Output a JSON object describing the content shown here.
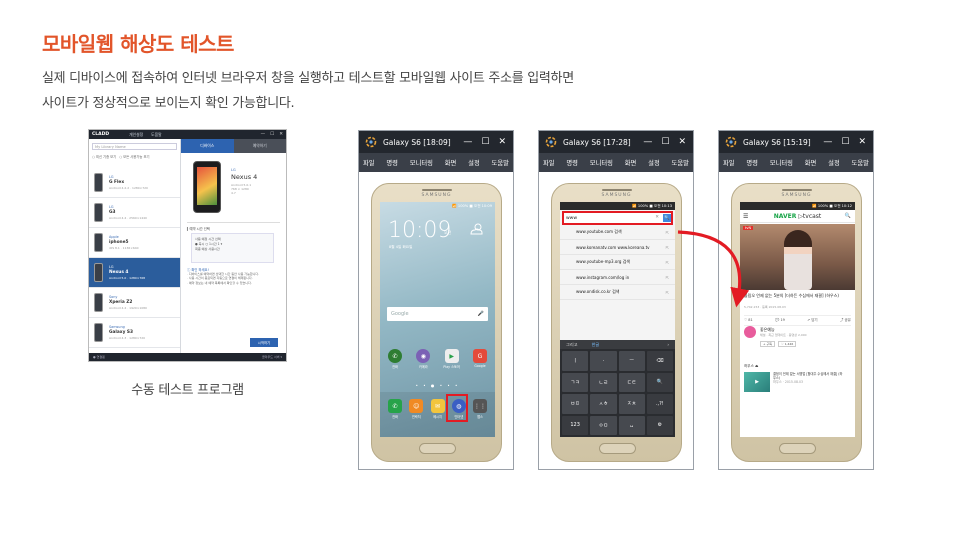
{
  "header": {
    "title": "모바일웹 해상도 테스트",
    "desc_line1": "실제 디바이스에 접속하여 인터넷 브라우저 창을 실행하고 테스트할 모바일웹 사이트 주소를 입력하면",
    "desc_line2": "사이트가 정상적으로 보이는지 확인 가능합니다."
  },
  "program": {
    "logo": "CLADD",
    "menu1": "개인설정",
    "menu2": "도움말",
    "win_min": "—",
    "win_max": "☐",
    "win_close": "✕",
    "search_placeholder": "My Library Name",
    "filter1": "○ 최신 기종 보기",
    "filter2": "○ 모든 사용가능 보기",
    "tab_active": "디바이스",
    "tab_inactive": "예약하기",
    "devices": [
      {
        "brand": "LG",
        "model": "G Flex",
        "spec": "Android 4.2.2 · 1280×720"
      },
      {
        "brand": "LG",
        "model": "G3",
        "spec": "Android 4.4 · 2560×1440"
      },
      {
        "brand": "Apple",
        "model": "iphone5",
        "spec": "iOS 8.1 · 1136×640"
      },
      {
        "brand": "LG",
        "model": "Nexus 4",
        "spec": "Android 5.0 · 1280×768"
      },
      {
        "brand": "Sony",
        "model": "Xperia Z2",
        "spec": "Android 4.4 · 1920×1080"
      },
      {
        "brand": "Samsung",
        "model": "Galaxy S3",
        "spec": "Android 4.3 · 1280×720"
      }
    ],
    "detail_brand": "LG",
    "detail_model": "Nexus 4",
    "detail_spec1": "Android 5.0.1",
    "detail_spec2": "768 × 1280",
    "detail_spec3": "4.7",
    "section_title": "▎예약 시간 선택",
    "box_line1": "사용 예정 시간 선택",
    "box_line2": "● 즉시   ○ 1시간   1 ▾",
    "box_line3": "최종 예상 사용시간",
    "notes_title": "ⓘ 확인 하세요!",
    "note1": "· 디바이스를 예약하면 선택한 시간 동안 사용 가능합니다.",
    "note2": "· 사용 시간이 종료되면 자동으로 연결이 해제됩니다.",
    "note3": "· 예약 정보는 내 예약 목록에서 확인할 수 있습니다.",
    "start_button": "시작하기",
    "status_left": "● 연결됨",
    "status_right": "클라우드 서버 ▾"
  },
  "program_caption": "수동 테스트 프로그램",
  "emulators": [
    {
      "title": "Galaxy S6  [18:09]"
    },
    {
      "title": "Galaxy S6  [17:28]"
    },
    {
      "title": "Galaxy S6  [15:19]"
    }
  ],
  "emu_menu": [
    "파일",
    "명령",
    "모니터링",
    "화면",
    "설정",
    "도움말"
  ],
  "emu_ctrls": {
    "min": "—",
    "max": "☐",
    "close": "✕"
  },
  "phone": {
    "brand": "SAMSUNG",
    "status1": "📶 100% ■ 오전 10:09",
    "status2": "📶 100% ■ 오전 10:13",
    "status3": "📶 100% ■ 오전 10:12"
  },
  "home": {
    "clock": "10:09",
    "ampm": "오전",
    "date": "8월 4일 화요일",
    "google": "Google",
    "mic": "🎤",
    "apps_row1": [
      {
        "label": "전화",
        "glyph": "✆",
        "color": "#2e7d32"
      },
      {
        "label": "카메라",
        "glyph": "◉",
        "color": "#7b61b5"
      },
      {
        "label": "Play 스토어",
        "glyph": "▶",
        "color": "#eeeeee"
      },
      {
        "label": "Google",
        "glyph": "G",
        "color": "#e44a3b"
      }
    ],
    "dots": "• • ● • • •",
    "apps_dock": [
      {
        "label": "전화",
        "glyph": "✆",
        "color": "#27a34a"
      },
      {
        "label": "연락처",
        "glyph": "☺",
        "color": "#f08a24"
      },
      {
        "label": "메시지",
        "glyph": "✉",
        "color": "#f2c53d"
      },
      {
        "label": "인터넷",
        "glyph": "◍",
        "color": "#3b5fc4"
      },
      {
        "label": "앱스",
        "glyph": "⋮⋮",
        "color": "#555555"
      }
    ]
  },
  "browser": {
    "url": "www",
    "clear": "✕",
    "go": "🔍",
    "suggestions": [
      "www.youtube.com 검색",
      "www.koreanatv.com www.koreana.tv",
      "www.youtube-mp3.org 검색",
      "www.instagram.com/log in",
      "www.ondisk.co.kr 검색"
    ],
    "suggest_arrow": "⇱",
    "kb_top_left": "그리고",
    "kb_top_lang": "한글",
    "kb_top_right": "›",
    "keys": [
      "ㅣ",
      "·",
      "ㅡ",
      "⌫",
      "ㄱㅋ",
      "ㄴㄹ",
      "ㄷㅌ",
      "🔍",
      "ㅂㅍ",
      "ㅅㅎ",
      "ㅈㅊ",
      ".,?!",
      "123",
      "ㅇㅁ",
      "␣",
      "⚙"
    ]
  },
  "tvcast": {
    "menu": "☰",
    "brand": "NAVER",
    "brand_tv": "▷tvcast",
    "search": "🔍",
    "video_logo": "tvN",
    "title": "올림오 언제 없는 5분의 [더하든 수심에서 재결] (하우스)",
    "meta": "5,742,153 · 등록 2015.08.03",
    "actions": [
      "♡ 81",
      "💬 19",
      "↗ 담기",
      "⤴ 공유"
    ],
    "channel_name": "좋은예능",
    "channel_sub": "채널 · 최근 업데이트 · 동영상 2,000",
    "ch_btn1": "+ 구독",
    "ch_btn2": "♡ 1,446",
    "playlist_head": "하우스 ⏏",
    "pl_title": "결정이 언제 없는 서명업 [합대주 수심에서 재결] (하우스)",
    "pl_meta": "하우스 · 2015.08.03"
  }
}
